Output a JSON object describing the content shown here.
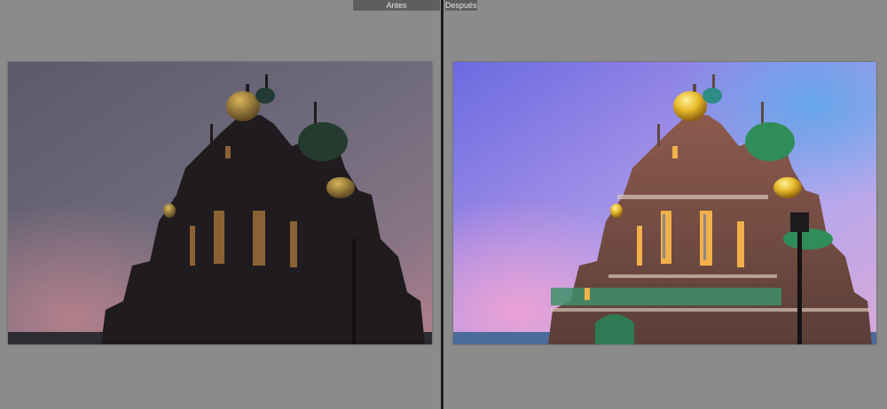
{
  "compare_view": {
    "before_label": "Antes",
    "after_label": "Después"
  },
  "colors": {
    "panel_bg": "#8b8b8b",
    "tab_bg": "#5e5e5e",
    "divider": "#1c1c1c"
  }
}
